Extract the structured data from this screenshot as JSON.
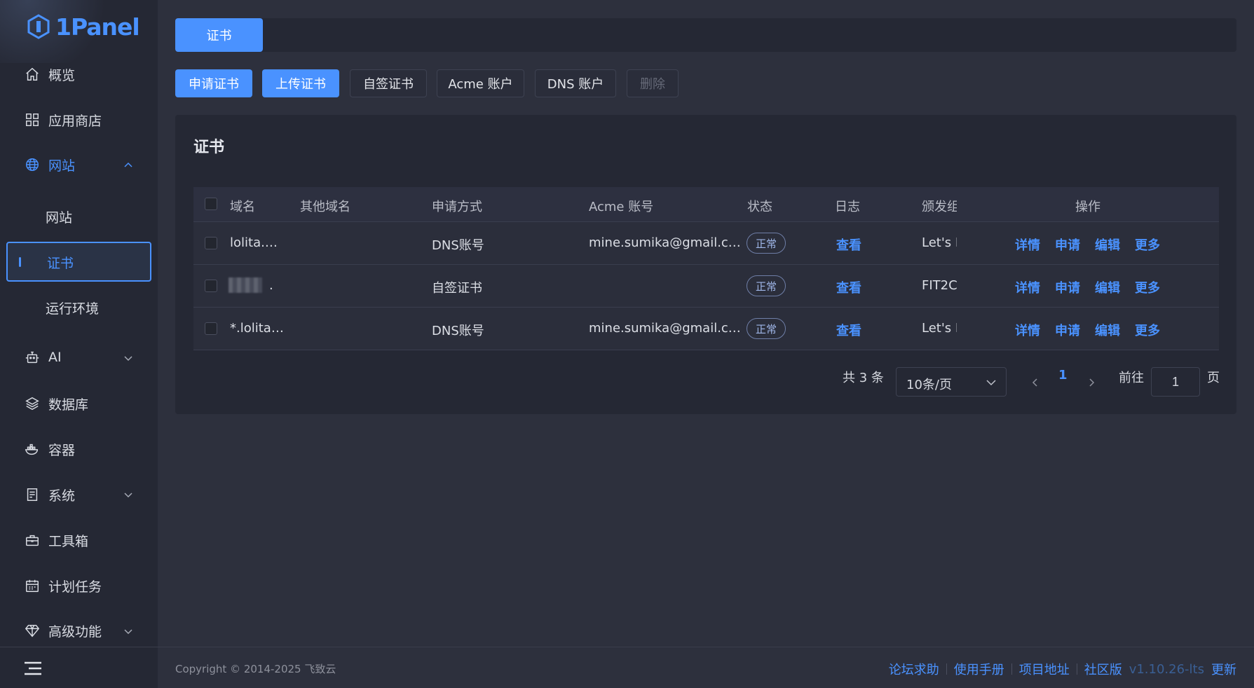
{
  "app": {
    "name": "1Panel"
  },
  "sidebar": {
    "items": [
      {
        "label": "概览",
        "icon": "home-icon"
      },
      {
        "label": "应用商店",
        "icon": "grid-icon"
      },
      {
        "label": "网站",
        "icon": "globe-icon",
        "expanded": true
      },
      {
        "label": "AI",
        "icon": "robot-icon"
      },
      {
        "label": "数据库",
        "icon": "layers-icon"
      },
      {
        "label": "容器",
        "icon": "container-icon"
      },
      {
        "label": "系统",
        "icon": "server-icon"
      },
      {
        "label": "工具箱",
        "icon": "toolbox-icon"
      },
      {
        "label": "计划任务",
        "icon": "calendar-icon"
      },
      {
        "label": "高级功能",
        "icon": "diamond-icon"
      }
    ],
    "subitems": [
      {
        "label": "网站"
      },
      {
        "label": "证书",
        "active": true
      },
      {
        "label": "运行环境"
      }
    ]
  },
  "tabs": {
    "active": "证书"
  },
  "toolbar": {
    "apply": "申请证书",
    "upload": "上传证书",
    "selfsigned": "自签证书",
    "acme": "Acme 账户",
    "dns": "DNS 账户",
    "delete": "删除"
  },
  "card": {
    "title": "证书"
  },
  "table": {
    "headers": [
      "域名",
      "其他域名",
      "申请方式",
      "Acme 账号",
      "状态",
      "日志",
      "颁发组",
      "操作"
    ],
    "header_issuer_visible": "颁发组",
    "rows": [
      {
        "domain": "lolita.…",
        "other": "",
        "method": "DNS账号",
        "acme": "mine.sumika@gmail.c…",
        "status": "正常",
        "log": "查看",
        "issuer": "Let's E"
      },
      {
        "domain": ".",
        "other": "",
        "method": "自签证书",
        "acme": "",
        "status": "正常",
        "log": "查看",
        "issuer": "FIT2C"
      },
      {
        "domain": "*.lolita…",
        "other": "",
        "method": "DNS账号",
        "acme": "mine.sumika@gmail.c…",
        "status": "正常",
        "log": "查看",
        "issuer": "Let's E"
      }
    ],
    "actions": [
      "详情",
      "申请",
      "编辑",
      "更多"
    ]
  },
  "pagination": {
    "total": "共 3 条",
    "page_size": "10条/页",
    "current_page": "1",
    "goto_label": "前往",
    "goto_value": "1",
    "page_suffix": "页"
  },
  "footer": {
    "copyright": "Copyright © 2014-2025 飞致云",
    "links": [
      "论坛求助",
      "使用手册",
      "项目地址",
      "社区版"
    ],
    "version": "v1.10.26-lts",
    "update": "更新"
  },
  "colors": {
    "accent": "#4a92ff",
    "sidebar_bg": "#252834",
    "page_bg": "#2d303d"
  }
}
